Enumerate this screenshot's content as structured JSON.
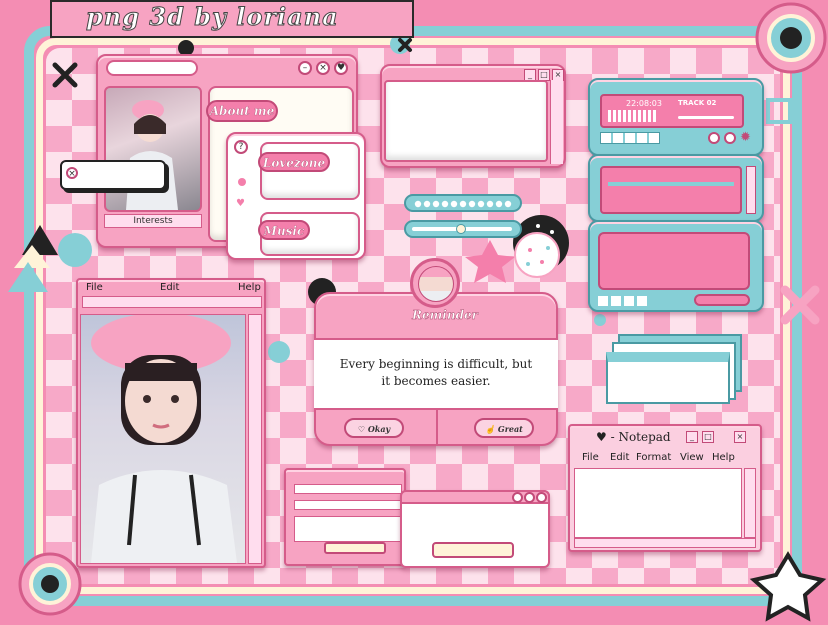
{
  "title": "png 3d by loriana",
  "profile_window": {
    "about_label": "About me",
    "interests_label": "Interests"
  },
  "links_window": {
    "lovezone_label": "Lovezone",
    "music_label": "Music"
  },
  "player": {
    "time": "22:08:03",
    "track": "TRACK 02"
  },
  "photo_window": {
    "menu": [
      "File",
      "Edit",
      "Help"
    ]
  },
  "reminder": {
    "title": "Reminder",
    "message": "Every beginning is difficult, but it becomes easier.",
    "okay_label": "Okay",
    "great_label": "Great"
  },
  "notepad": {
    "title": "- Notepad",
    "menu": [
      "File",
      "Edit",
      "Format",
      "View",
      "Help"
    ]
  },
  "colors": {
    "pink": "#f7a3c2",
    "hot_pink": "#f47fab",
    "teal": "#86cfd6",
    "cream": "#fff3d8"
  }
}
